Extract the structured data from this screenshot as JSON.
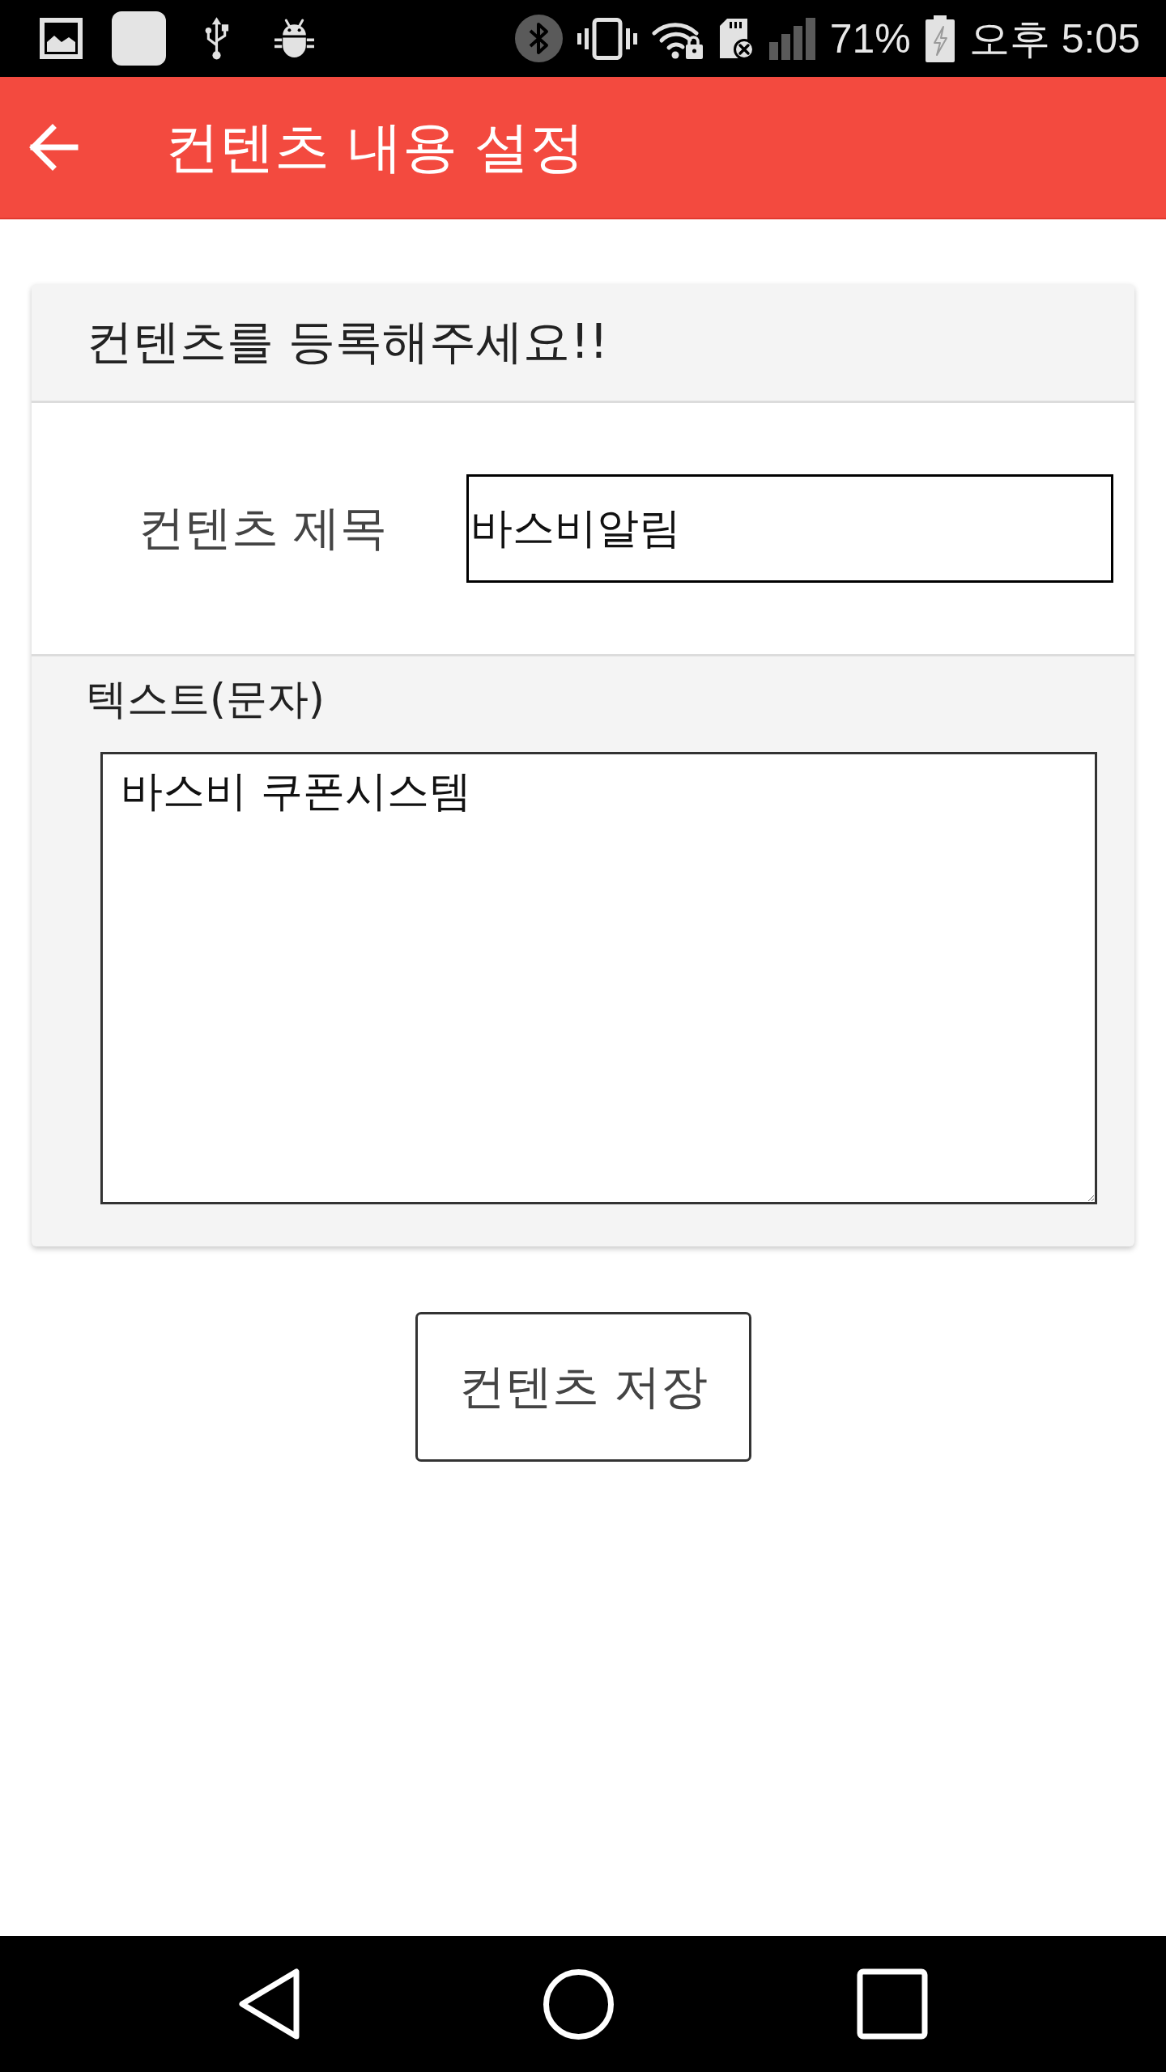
{
  "status_bar": {
    "battery": "71%",
    "time": "오후 5:05"
  },
  "app_bar": {
    "title": "컨텐츠 내용 설정"
  },
  "card": {
    "heading": "컨텐츠를 등록해주세요!!",
    "title_field": {
      "label": "컨텐츠 제목",
      "value": "바스비알림"
    },
    "text_field": {
      "label": "텍스트(문자)",
      "value": "바스비 쿠폰시스템"
    }
  },
  "save_button": {
    "label": "컨텐츠 저장"
  }
}
